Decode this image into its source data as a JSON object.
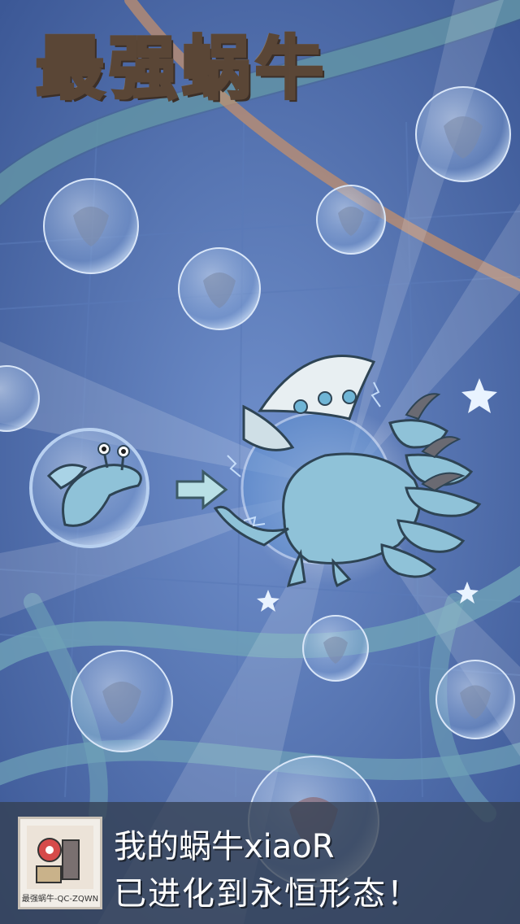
{
  "game": {
    "title_logo": "最强蜗牛",
    "colors": {
      "background": "#4a6aa8",
      "logo": "#d79645",
      "bubble": "#a9c3ea",
      "dragon": "#8fc2d8",
      "bar": "#344052"
    }
  },
  "evolution": {
    "from_icon": "baby-dragon-snail-icon",
    "arrow_icon": "right-arrow-icon",
    "to_icon": "multi-headed-dragon-icon"
  },
  "banner": {
    "qr_caption": "最强蜗牛-QC-ZQWN",
    "line1": "我的蜗牛xiaoR",
    "line2": "已进化到永恒形态！"
  }
}
